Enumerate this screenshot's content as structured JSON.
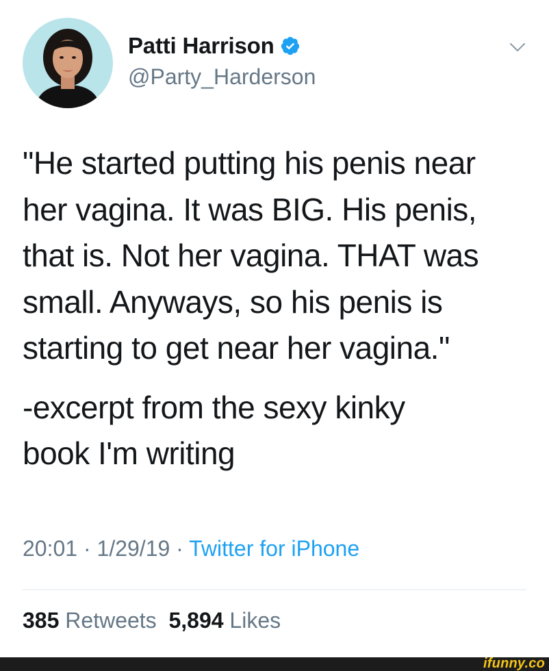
{
  "author": {
    "display_name": "Patti Harrison",
    "handle": "@Party_Harderson",
    "verified_icon": "verified-badge-icon",
    "menu_icon": "chevron-down-icon"
  },
  "tweet": {
    "paragraph_1": "\"He started putting his penis near\nher vagina. It was BIG. His penis,\nthat is. Not her vagina. THAT was\nsmall. Anyways, so his penis is\nstarting to get near her vagina.\"",
    "paragraph_2": "-excerpt from the sexy kinky\nbook I'm writing"
  },
  "meta": {
    "time": "20:01",
    "separator": "·",
    "date": "1/29/19",
    "source": "Twitter for iPhone"
  },
  "stats": {
    "retweets_count": "385",
    "retweets_label": "Retweets",
    "likes_count": "5,894",
    "likes_label": "Likes"
  },
  "watermark": {
    "text": "ifunny.co"
  },
  "colors": {
    "text_primary": "#14171a",
    "text_secondary": "#657786",
    "link_blue": "#1da1f2",
    "divider": "#e1e8ed",
    "footer_bar": "#1c1c1c",
    "watermark_yellow": "#f5c518"
  }
}
